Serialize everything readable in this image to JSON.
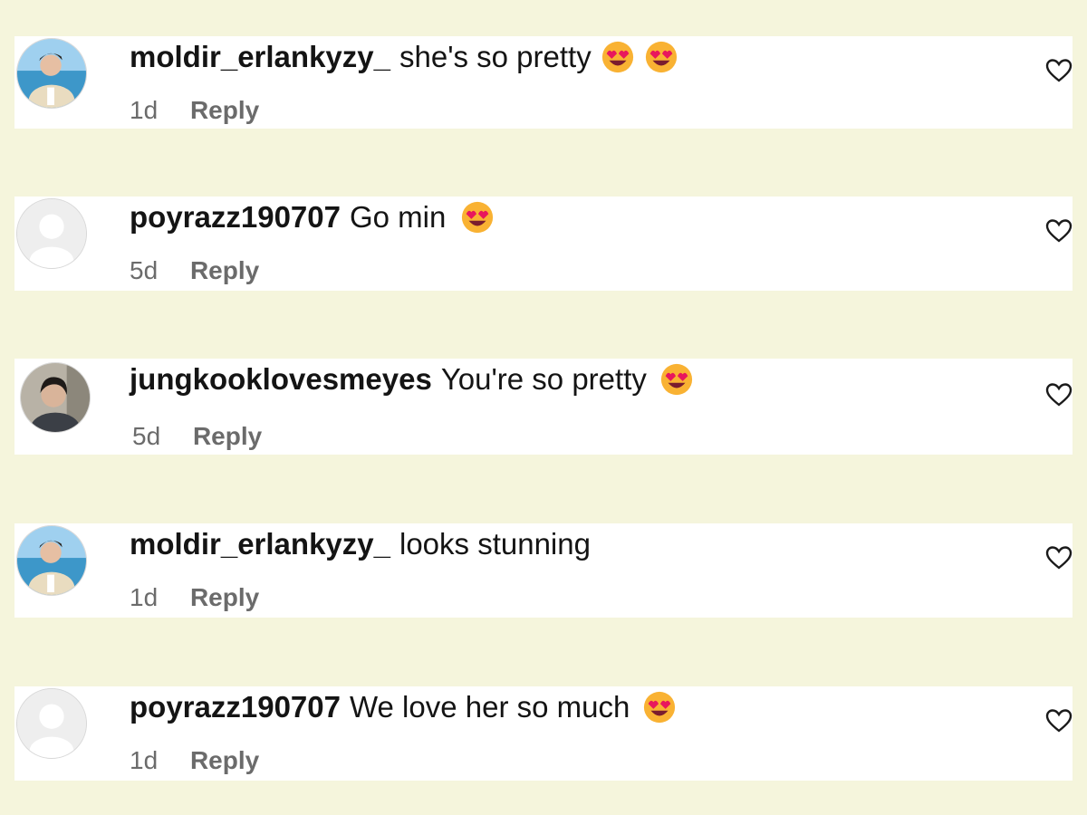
{
  "colors": {
    "page_background": "#f5f5dc",
    "card_background": "#ffffff",
    "username": "#141414",
    "meta_text": "#6b6b6b"
  },
  "comments": [
    {
      "username": "moldir_erlankyzy_",
      "text": "she's so pretty",
      "emoji": [
        "smiling-face-with-heart-eyes",
        "smiling-face-with-heart-eyes"
      ],
      "time": "1d",
      "reply_label": "Reply",
      "avatar": "photo-man-by-sea",
      "like_icon": "heart-outline-icon"
    },
    {
      "username": "poyrazz190707",
      "text": "Go min",
      "emoji": [
        "smiling-face-with-heart-eyes"
      ],
      "time": "5d",
      "reply_label": "Reply",
      "avatar": "default-profile-placeholder",
      "like_icon": "heart-outline-icon"
    },
    {
      "username": "jungkooklovesmeyes",
      "text": "You're so pretty",
      "emoji": [
        "smiling-face-with-heart-eyes"
      ],
      "time": "5d",
      "reply_label": "Reply",
      "avatar": "photo-man-portrait",
      "like_icon": "heart-outline-icon"
    },
    {
      "username": "moldir_erlankyzy_",
      "text": "looks stunning",
      "emoji": [],
      "time": "1d",
      "reply_label": "Reply",
      "avatar": "photo-man-by-sea",
      "like_icon": "heart-outline-icon"
    },
    {
      "username": "poyrazz190707",
      "text": "We love her so much",
      "emoji": [
        "smiling-face-with-heart-eyes"
      ],
      "time": "1d",
      "reply_label": "Reply",
      "avatar": "default-profile-placeholder",
      "like_icon": "heart-outline-icon"
    }
  ]
}
